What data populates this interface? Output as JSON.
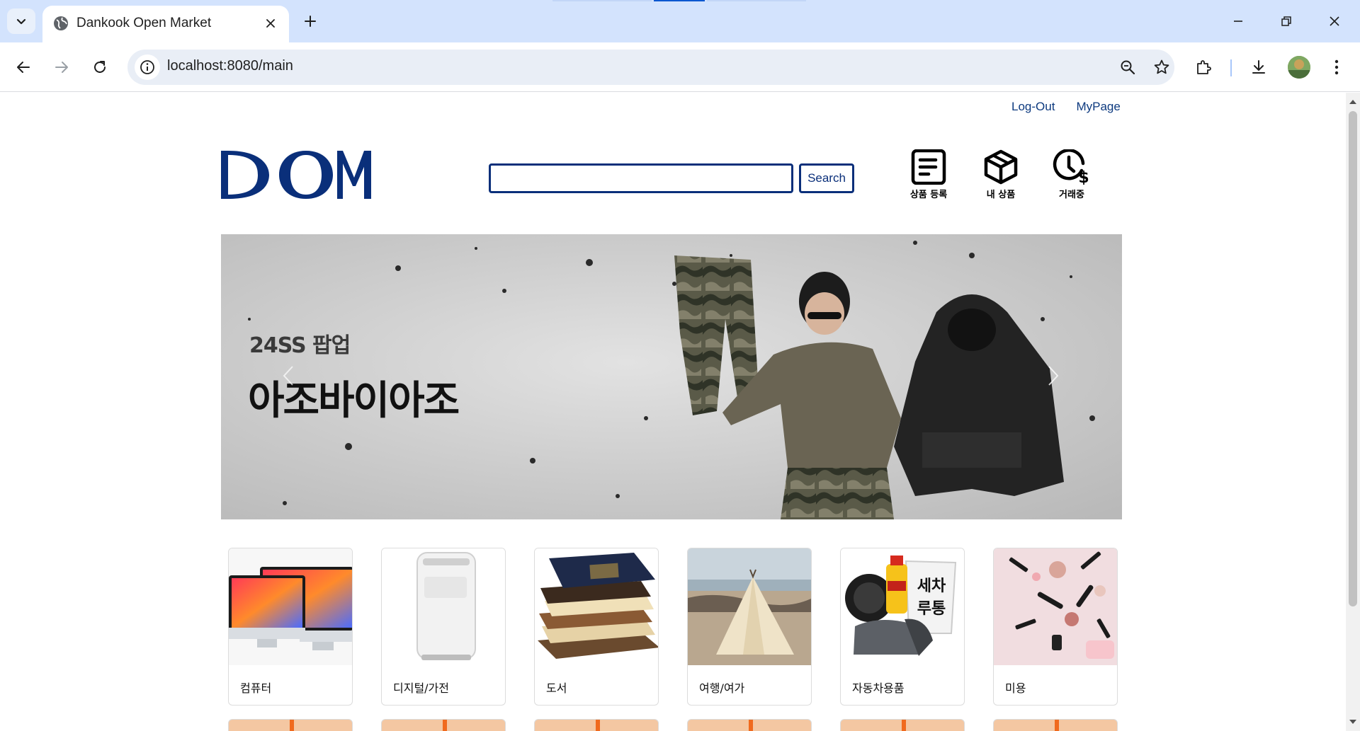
{
  "browser": {
    "tab_title": "Dankook Open Market",
    "url": "localhost:8080/main",
    "colors": {
      "tabbar": "#d3e3fd",
      "accent": "#0b57d0"
    }
  },
  "page": {
    "top_links": [
      "Log-Out",
      "MyPage"
    ],
    "logo_text": "DOM",
    "search": {
      "value": "",
      "placeholder": "",
      "button": "Search"
    },
    "quick_actions": [
      {
        "label": "상품 등록",
        "icon": "document-list-icon"
      },
      {
        "label": "내 상품",
        "icon": "box-icon"
      },
      {
        "label": "거래중",
        "icon": "clock-dollar-icon"
      }
    ],
    "banner": {
      "subtitle": "24SS 팝업",
      "title": "아조바이아조"
    },
    "categories": [
      {
        "label": "컴퓨터",
        "icon": "computer-image"
      },
      {
        "label": "디지털/가전",
        "icon": "appliance-image"
      },
      {
        "label": "도서",
        "icon": "books-image"
      },
      {
        "label": "여행/여가",
        "icon": "tent-image"
      },
      {
        "label": "자동차용품",
        "icon": "car-wash-image"
      },
      {
        "label": "미용",
        "icon": "cosmetics-image"
      }
    ],
    "colors": {
      "brand": "#0a2f7a",
      "link": "#0d3a7f"
    }
  }
}
